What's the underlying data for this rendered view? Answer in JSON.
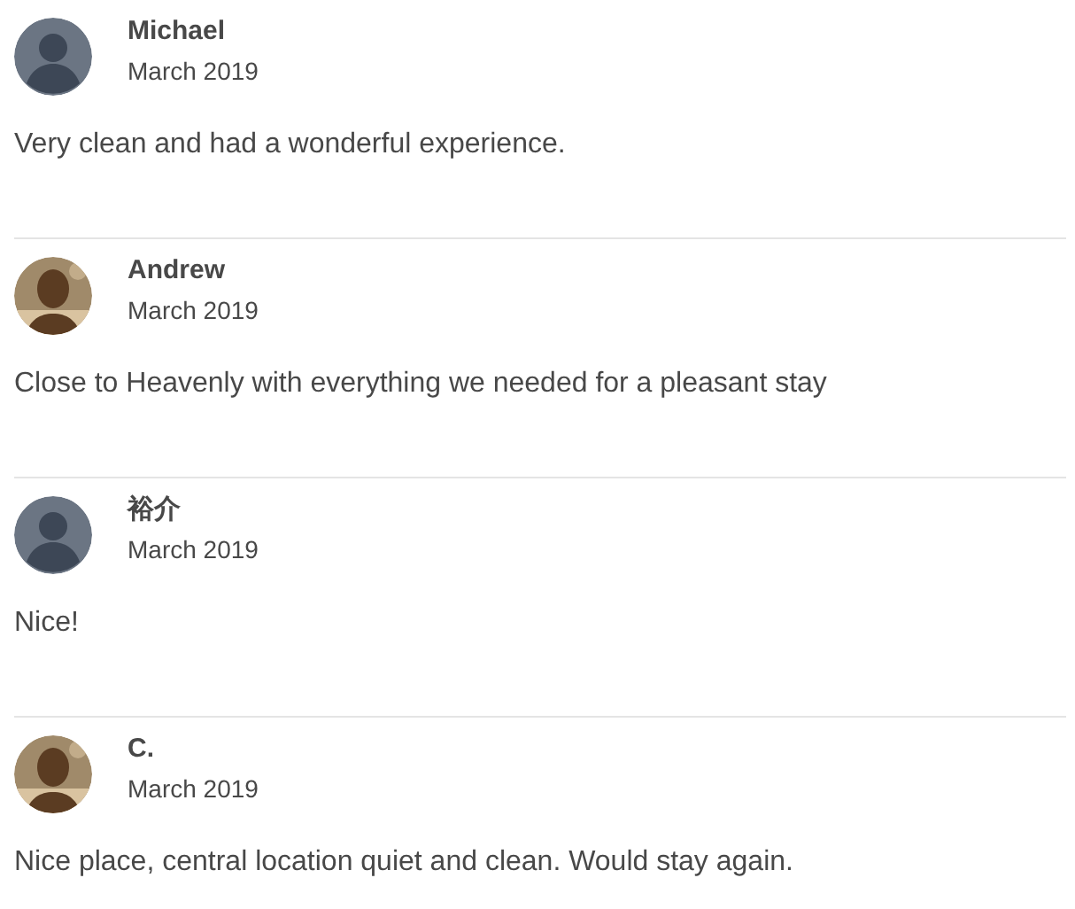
{
  "reviews": [
    {
      "name": "Michael",
      "date": "March 2019",
      "avatar": {
        "kind": "silhouette"
      },
      "comment": "Very clean and had a wonderful experience."
    },
    {
      "name": "Andrew",
      "date": "March 2019",
      "comment": "Close to Heavenly with everything we needed for a pleasant stay"
    },
    {
      "name": "裕介",
      "date": "March 2019",
      "avatar": {
        "kind": "silhouette"
      },
      "comment": "Nice!"
    },
    {
      "name": "C.",
      "date": "March 2019",
      "comment": "Nice place, central location quiet and clean. Would stay again."
    }
  ]
}
